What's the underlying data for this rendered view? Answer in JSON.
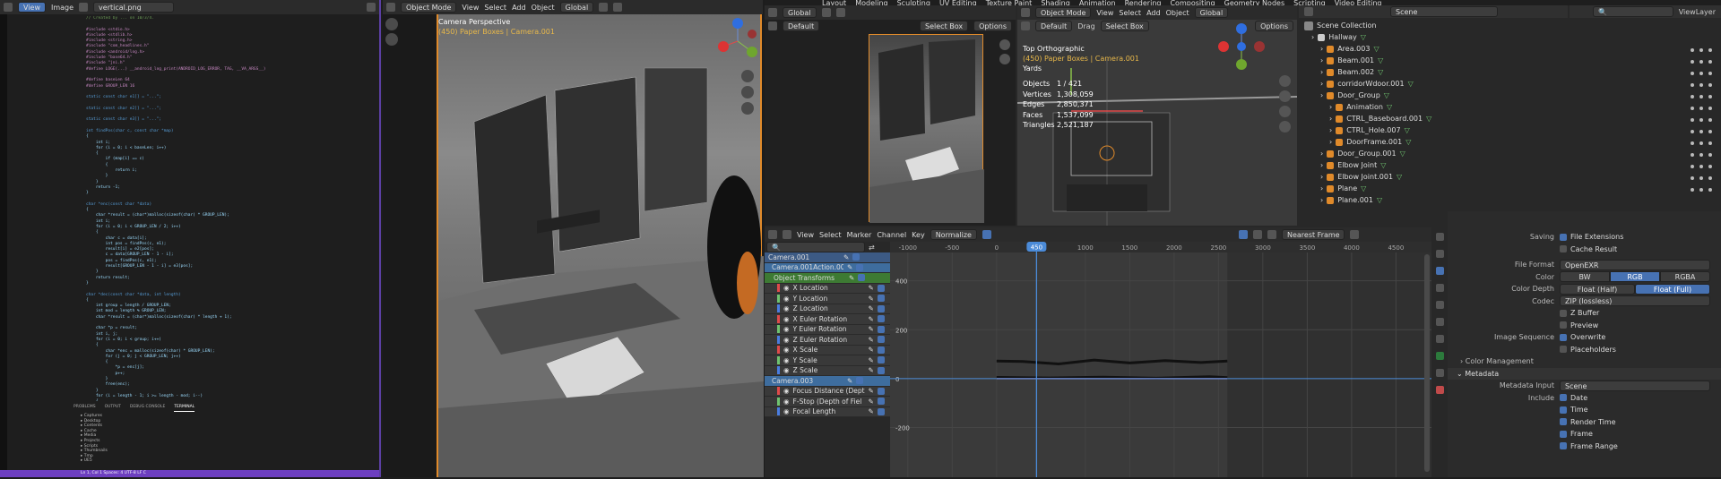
{
  "code_editor": {
    "menu": [
      "View",
      "Image"
    ],
    "tab_title": "vertical.png",
    "lines": [
      "// Created by ... on 10/3/4.",
      "",
      "#include <stdio.h>",
      "#include <stdlib.h>",
      "#include <string.h>",
      "#include \"com_headlines.h\"",
      "#include <android/log.h>",
      "#include \"base64.h\"",
      "#include \"jni.h\"",
      "#define LOGE(...) __android_log_print(ANDROID_LOG_ERROR, TAG, __VA_ARGS__)",
      "",
      "#define baseLen 64",
      "#define GROUP_LEN 16",
      "",
      "static const char e1[] = \"...\";",
      "",
      "static const char e2[] = \"...\";",
      "",
      "static const char e3[] = \"...\";",
      "",
      "int findPos(char c, const char *map)",
      "{",
      "    int i;",
      "    for (i = 0; i < baseLen; i++)",
      "    {",
      "        if (map[i] == c)",
      "        {",
      "            return i;",
      "        }",
      "    }",
      "    return -1;",
      "}",
      "",
      "char *enc(const char *data)",
      "{",
      "    char *result = (char*)malloc(sizeof(char) * GROUP_LEN);",
      "    int i;",
      "    for (i = 0; i < GROUP_LEN / 2; i++)",
      "    {",
      "        char c = data[i];",
      "        int pos = findPos(c, e1);",
      "        result[i] = e2[pos];",
      "        c = data[GROUP_LEN - 1 - i];",
      "        pos = findPos(c, e1);",
      "        result[GROUP_LEN - 1 - i] = e3[pos];",
      "    }",
      "    return result;",
      "}",
      "",
      "char *dec(const char *data, int length)",
      "{",
      "    int group = length / GROUP_LEN;",
      "    int mod = length % GROUP_LEN;",
      "    char *result = (char*)malloc(sizeof(char) * length + 1);",
      "",
      "    char *p = result;",
      "    int i, j;",
      "    for (i = 0; i < group; i++)",
      "    {",
      "        char *enc = malloc(sizeof(char) * GROUP_LEN);",
      "        for (j = 0; j < GROUP_LEN; j++)",
      "        {",
      "            *p = enc[j];",
      "            p++;",
      "        }",
      "        free(enc);",
      "    }",
      "    for (i = length - 1; i >= length - mod; i--)",
      "    {",
      "        char c = data[i];",
      "        int pos = findPos(c, e1);",
      "        *p = e1[pos];",
      "        p++;",
      "    }",
      "    *p = '\\0';",
      "",
      "    return result;",
      "}"
    ],
    "bottom_tabs": [
      "PROBLEMS",
      "OUTPUT",
      "DEBUG CONSOLE",
      "TERMINAL"
    ],
    "file_tree": [
      "Captures",
      "Desktop",
      "Contents",
      "Cache",
      "Media",
      "Projects",
      "Scripts",
      "Thumbnails",
      "Tmp",
      "UE5"
    ],
    "status": "Ln 1, Col 1   Spaces: 4   UTF-8   LF   C"
  },
  "viewport_left": {
    "mode": "Object Mode",
    "orientation": "Global",
    "menu": [
      "View",
      "Select",
      "Add",
      "Object"
    ],
    "title": "Camera Perspective",
    "subtitle": "(450) Paper Boxes | Camera.001"
  },
  "blender_top": {
    "menu_items": [
      "File",
      "Edit",
      "Render",
      "Window",
      "Help"
    ],
    "workspace_tabs": [
      "Layout",
      "Modeling",
      "Sculpting",
      "UV Editing",
      "Texture Paint",
      "Shading",
      "Animation",
      "Rendering",
      "Compositing",
      "Geometry Nodes",
      "Scripting",
      "Video Editing"
    ],
    "scene": "Scene",
    "view_layer": "ViewLayer"
  },
  "camera_view": {
    "mode": "Object Mode",
    "menu": [
      "View",
      "Select",
      "Add"
    ],
    "orientation": "Global",
    "transform": "Default",
    "select_box": "Select Box",
    "options": "Options"
  },
  "ortho_view": {
    "mode": "Object Mode",
    "menu": [
      "View",
      "Select",
      "Add",
      "Object"
    ],
    "orientation": "Global",
    "transform": "Default",
    "drag_label": "Drag",
    "select_box": "Select Box",
    "options": "Options",
    "title": "Top Orthographic",
    "subtitle": "(450) Paper Boxes | Camera.001",
    "units": "Yards",
    "stats": [
      {
        "label": "Objects",
        "value": "1 / 421"
      },
      {
        "label": "Vertices",
        "value": "1,308,059"
      },
      {
        "label": "Edges",
        "value": "2,850,371"
      },
      {
        "label": "Faces",
        "value": "1,537,099"
      },
      {
        "label": "Triangles",
        "value": "2,521,187"
      }
    ]
  },
  "outliner": {
    "title": "Scene Collection",
    "items": [
      {
        "name": "Hallway",
        "indent": 0
      },
      {
        "name": "Area.003",
        "indent": 1
      },
      {
        "name": "Beam.001",
        "indent": 1
      },
      {
        "name": "Beam.002",
        "indent": 1
      },
      {
        "name": "corridorWdoor.001",
        "indent": 1
      },
      {
        "name": "Door_Group",
        "indent": 1
      },
      {
        "name": "Animation",
        "indent": 2
      },
      {
        "name": "CTRL_Baseboard.001",
        "indent": 2
      },
      {
        "name": "CTRL_Hole.007",
        "indent": 2
      },
      {
        "name": "DoorFrame.001",
        "indent": 2
      },
      {
        "name": "Door_Group.001",
        "indent": 1
      },
      {
        "name": "Elbow Joint",
        "indent": 1
      },
      {
        "name": "Elbow Joint.001",
        "indent": 1
      },
      {
        "name": "Plane",
        "indent": 1
      },
      {
        "name": "Plane.001",
        "indent": 1
      }
    ]
  },
  "graph_editor": {
    "menu": [
      "View",
      "Select",
      "Marker",
      "Channel",
      "Key"
    ],
    "normalize": "Normalize",
    "interpolation": "Nearest Frame",
    "current_frame": "450",
    "frame_ticks": [
      "-1000",
      "-500",
      "0",
      "450",
      "1000",
      "1500",
      "2000",
      "2500",
      "3000",
      "3500",
      "4000",
      "4500"
    ],
    "value_ticks": [
      "400",
      "200",
      "0",
      "-200"
    ],
    "channels": [
      {
        "name": "Camera.001",
        "type": "object"
      },
      {
        "name": "Camera.001Action.006",
        "type": "action"
      },
      {
        "name": "Object Transforms",
        "type": "group"
      },
      {
        "name": "X Location",
        "type": "fcurve"
      },
      {
        "name": "Y Location",
        "type": "fcurve"
      },
      {
        "name": "Z Location",
        "type": "fcurve"
      },
      {
        "name": "X Euler Rotation",
        "type": "fcurve"
      },
      {
        "name": "Y Euler Rotation",
        "type": "fcurve"
      },
      {
        "name": "Z Euler Rotation",
        "type": "fcurve"
      },
      {
        "name": "X Scale",
        "type": "fcurve"
      },
      {
        "name": "Y Scale",
        "type": "fcurve"
      },
      {
        "name": "Z Scale",
        "type": "fcurve"
      },
      {
        "name": "Camera.003",
        "type": "action"
      },
      {
        "name": "Focus Distance (Depth",
        "type": "fcurve"
      },
      {
        "name": "F-Stop (Depth of Fiel",
        "type": "fcurve"
      },
      {
        "name": "Focal Length",
        "type": "fcurve"
      }
    ]
  },
  "properties": {
    "saving_label": "Saving",
    "file_extensions": "File Extensions",
    "cache_result": "Cache Result",
    "file_format_label": "File Format",
    "file_format": "OpenEXR",
    "color_label": "Color",
    "color_options": [
      "BW",
      "RGB",
      "RGBA"
    ],
    "color_selected": "RGB",
    "color_depth_label": "Color Depth",
    "depth_options": [
      "Float (Half)",
      "Float (Full)"
    ],
    "depth_selected": "Float (Full)",
    "codec_label": "Codec",
    "codec": "ZIP (lossless)",
    "z_buffer": "Z Buffer",
    "preview": "Preview",
    "image_sequence_label": "Image Sequence",
    "overwrite": "Overwrite",
    "placeholders": "Placeholders",
    "color_management": "Color Management",
    "metadata": "Metadata",
    "metadata_input_label": "Metadata Input",
    "metadata_input": "Scene",
    "include_label": "Include",
    "include_items": [
      "Date",
      "Time",
      "Render Time",
      "Frame",
      "Frame Range"
    ]
  },
  "colors": {
    "selection": "#4772b3",
    "active_orange": "#e08a2a",
    "playhead": "#4b8bd8",
    "code_border": "#5b3fa3"
  }
}
